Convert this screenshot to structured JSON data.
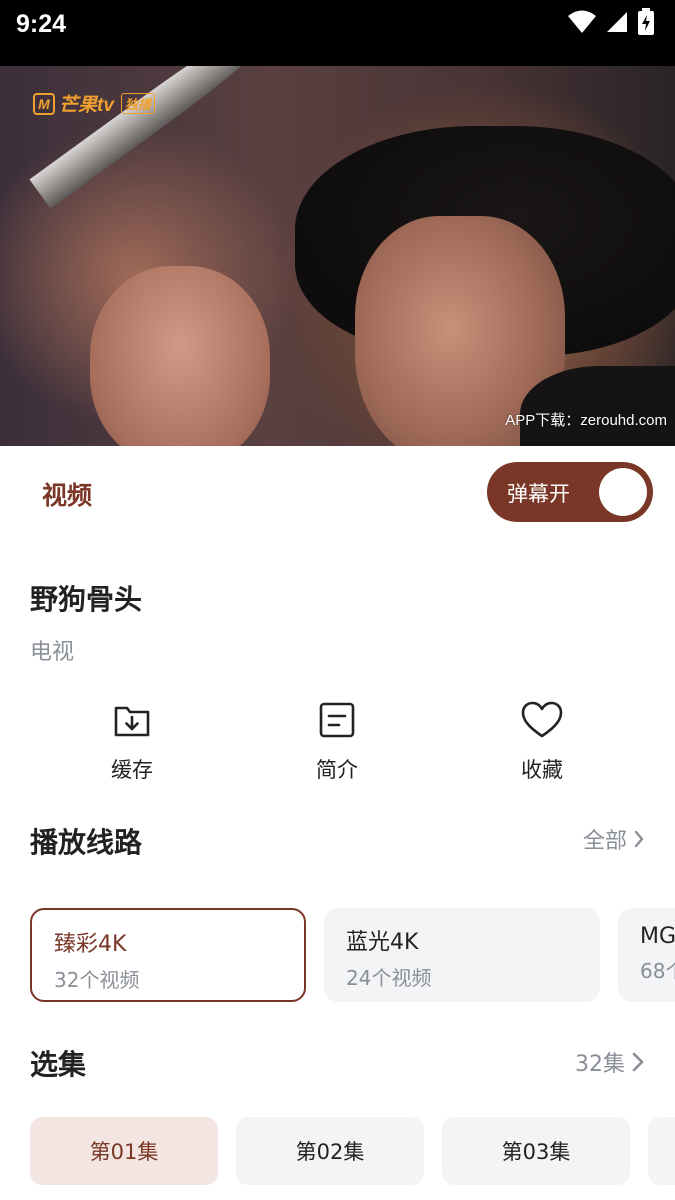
{
  "status_bar": {
    "time": "9:24"
  },
  "video": {
    "logo_text": "芒果tv",
    "logo_badge": "独播",
    "watermark": "APP下载：zerouhd.com"
  },
  "tab": {
    "label": "视频"
  },
  "danmaku": {
    "label": "弹幕开",
    "enabled": true
  },
  "show": {
    "title": "野狗骨头",
    "category": "电视"
  },
  "actions": [
    {
      "label": "缓存",
      "icon": "download-folder-icon"
    },
    {
      "label": "简介",
      "icon": "document-icon"
    },
    {
      "label": "收藏",
      "icon": "heart-icon"
    }
  ],
  "routes_section": {
    "title": "播放线路",
    "more_label": "全部"
  },
  "routes": [
    {
      "name": "臻彩4K",
      "count": "32个视频",
      "selected": true
    },
    {
      "name": "蓝光4K",
      "count": "24个视频",
      "selected": false
    },
    {
      "name": "MG",
      "count": "68个",
      "selected": false
    }
  ],
  "episodes_section": {
    "title": "选集",
    "count_label": "32集"
  },
  "episodes": [
    {
      "label": "第01集",
      "selected": true
    },
    {
      "label": "第02集",
      "selected": false
    },
    {
      "label": "第03集",
      "selected": false
    }
  ],
  "colors": {
    "accent": "#7a3626",
    "accent_light": "#f3e6e2",
    "muted": "#8a8f98",
    "card_bg": "#f3f4f6"
  }
}
